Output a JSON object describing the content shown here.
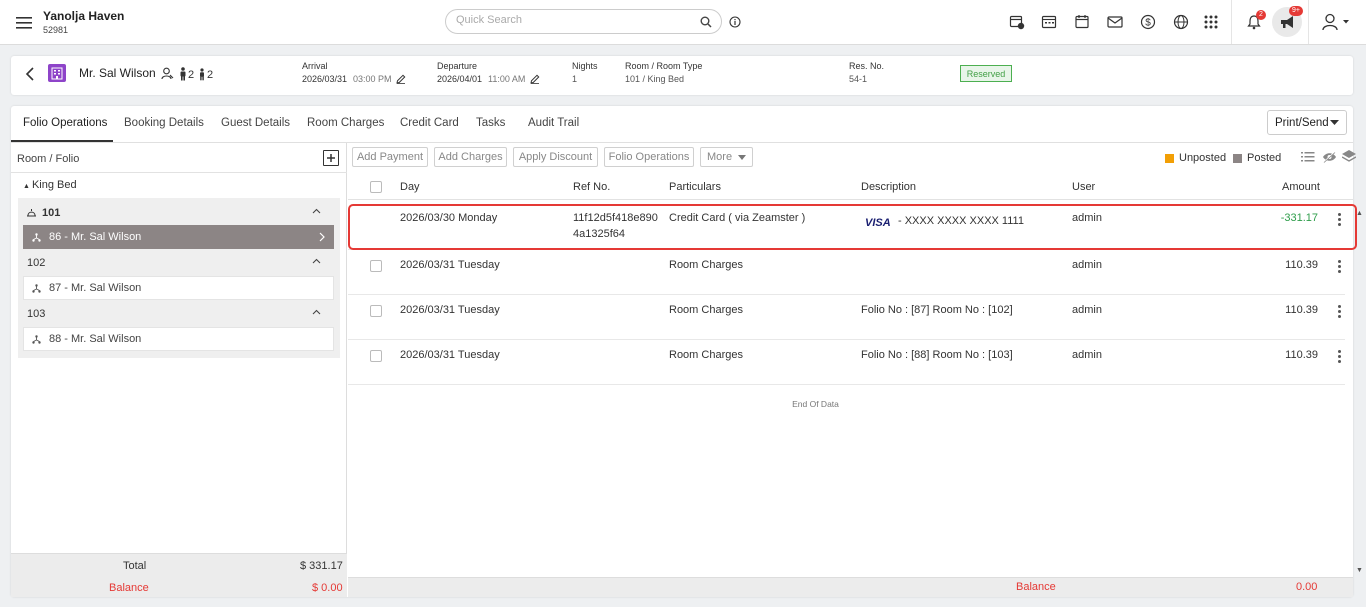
{
  "header": {
    "hotel_name": "Yanolja Haven",
    "hotel_code": "52981",
    "search_placeholder": "Quick Search",
    "notifications_badge": "2",
    "announcements_badge": "9+"
  },
  "reservation": {
    "guest_name": "Mr. Sal Wilson",
    "adults": "2",
    "children": "2",
    "arrival_label": "Arrival",
    "arrival_date": "2026/03/31",
    "arrival_time": "03:00 PM",
    "departure_label": "Departure",
    "departure_date": "2026/04/01",
    "departure_time": "11:00 AM",
    "nights_label": "Nights",
    "nights": "1",
    "room_label": "Room / Room Type",
    "room_value": "101 / King Bed",
    "res_label": "Res. No.",
    "res_value": "54-1",
    "status": "Reserved",
    "status_color": "#43a047"
  },
  "tabs": [
    "Folio Operations",
    "Booking Details",
    "Guest Details",
    "Room Charges",
    "Credit Card",
    "Tasks",
    "Audit Trail"
  ],
  "print_send": "Print/Send",
  "left_panel": {
    "title": "Room / Folio",
    "room_type": "King Bed",
    "rooms": [
      {
        "number": "101",
        "folio": "86 - Mr. Sal Wilson"
      },
      {
        "number": "102",
        "folio": "87 - Mr. Sal Wilson"
      },
      {
        "number": "103",
        "folio": "88 - Mr. Sal Wilson"
      }
    ],
    "total_label": "Total",
    "total_value": "$ 331.17",
    "balance_label": "Balance",
    "balance_value": "$ 0.00"
  },
  "toolbar": {
    "buttons": [
      "Add Payment",
      "Add Charges",
      "Apply Discount",
      "Folio Operations",
      "More"
    ],
    "unposted": "Unposted",
    "posted": "Posted",
    "unposted_color": "#f29f05",
    "posted_color": "#8c8585"
  },
  "table": {
    "columns": [
      "Day",
      "Ref No.",
      "Particulars",
      "Description",
      "User",
      "Amount"
    ],
    "rows": [
      {
        "day": "2026/03/30 Monday",
        "ref1": "11f12d5f418e890",
        "ref2": "4a1325f64",
        "particulars": "Credit Card ( via Zeamster )",
        "card_brand": "VISA",
        "description": "- XXXX XXXX XXXX 1111",
        "user": "admin",
        "amount": "-331.17"
      },
      {
        "day": "2026/03/31 Tuesday",
        "ref1": "",
        "ref2": "",
        "particulars": "Room Charges",
        "card_brand": "",
        "description": "",
        "user": "admin",
        "amount": "110.39"
      },
      {
        "day": "2026/03/31 Tuesday",
        "ref1": "",
        "ref2": "",
        "particulars": "Room Charges",
        "card_brand": "",
        "description": "Folio No : [87] Room No : [102]",
        "user": "admin",
        "amount": "110.39"
      },
      {
        "day": "2026/03/31 Tuesday",
        "ref1": "",
        "ref2": "",
        "particulars": "Room Charges",
        "card_brand": "",
        "description": "Folio No : [88] Room No : [103]",
        "user": "admin",
        "amount": "110.39"
      }
    ],
    "end_text": "End Of Data",
    "footer_balance_label": "Balance",
    "footer_balance_value": "0.00"
  },
  "colors": {
    "negative_amount": "#2e9d4a",
    "balance_red": "#e53935",
    "highlight": "#e53935"
  }
}
